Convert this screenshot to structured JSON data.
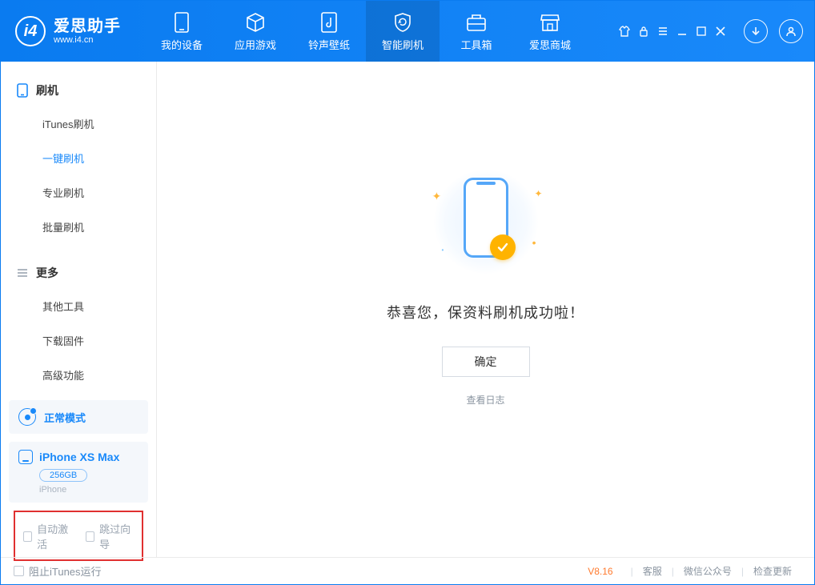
{
  "brand": {
    "cn": "爱思助手",
    "url": "www.i4.cn"
  },
  "tabs": [
    {
      "label": "我的设备"
    },
    {
      "label": "应用游戏"
    },
    {
      "label": "铃声壁纸"
    },
    {
      "label": "智能刷机"
    },
    {
      "label": "工具箱"
    },
    {
      "label": "爱思商城"
    }
  ],
  "sidebar": {
    "section1": {
      "title": "刷机",
      "items": [
        "iTunes刷机",
        "一键刷机",
        "专业刷机",
        "批量刷机"
      ]
    },
    "section2": {
      "title": "更多",
      "items": [
        "其他工具",
        "下载固件",
        "高级功能"
      ]
    }
  },
  "mode": {
    "label": "正常模式"
  },
  "device": {
    "name": "iPhone XS Max",
    "storage": "256GB",
    "type": "iPhone"
  },
  "options": {
    "auto_activate": "自动激活",
    "skip_guide": "跳过向导"
  },
  "main": {
    "success": "恭喜您，保资料刷机成功啦！",
    "ok": "确定",
    "view_log": "查看日志"
  },
  "footer": {
    "block_itunes": "阻止iTunes运行",
    "version": "V8.16",
    "service": "客服",
    "wechat": "微信公众号",
    "update": "检查更新"
  }
}
